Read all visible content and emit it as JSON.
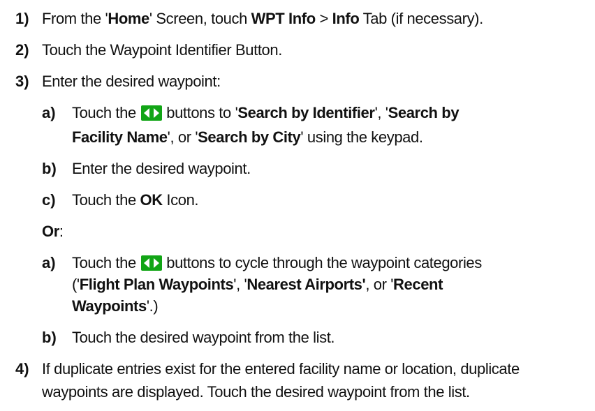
{
  "steps": [
    {
      "num": "1)",
      "t1": "From the '",
      "b1": "Home",
      "t2": "' Screen, touch ",
      "b2": "WPT Info",
      "t3": " > ",
      "b3": "Info",
      "t4": " Tab (if necessary)."
    },
    {
      "num": "2)",
      "text": "Touch the Waypoint Identifier Button."
    },
    {
      "num": "3)",
      "text": "Enter the desired waypoint:"
    },
    {
      "num": "4)",
      "line1": "If duplicate entries exist for the entered facility name or location, duplicate",
      "line2": "waypoints are displayed.  Touch the desired waypoint from the list."
    }
  ],
  "set1": {
    "a": {
      "label": "a)",
      "t1": "Touch the ",
      "t2": " buttons to '",
      "b1": "Search by Identifier",
      "t3": "', '",
      "b2": "Search by",
      "b3": "Facility Name",
      "t4": "', or '",
      "b4": "Search by City",
      "t5": "' using the keypad."
    },
    "b": {
      "label": "b)",
      "text": "Enter the desired waypoint."
    },
    "c": {
      "label": "c)",
      "t1": "Touch the ",
      "b1": "OK",
      "t2": " Icon."
    }
  },
  "or": {
    "label": "Or",
    "colon": ":"
  },
  "set2": {
    "a": {
      "label": "a)",
      "t1": "Touch the ",
      "t2": " buttons to cycle through the waypoint categories",
      "t3": "('",
      "b1": "Flight Plan Waypoints",
      "t4": "', '",
      "b2": "Nearest Airports'",
      "t5": ", or '",
      "b3": "Recent",
      "b4": "Waypoints",
      "t6": "'.)"
    },
    "b": {
      "label": "b)",
      "text": "Touch the desired waypoint from the list."
    }
  },
  "colors": {
    "arrow_button": "#12a516",
    "arrow_glyph": "#ffffff"
  },
  "icons": [
    "left-right-arrow-buttons-icon"
  ]
}
